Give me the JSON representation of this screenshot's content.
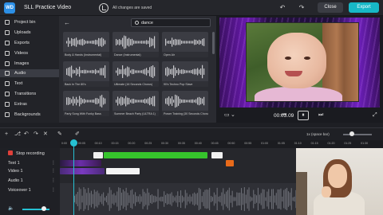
{
  "app": {
    "logo_text": "WD",
    "project_title": "SLL Practice Video",
    "save_status": "All changes are saved",
    "close_label": "Close",
    "export_label": "Export",
    "undo_glyph": "↶",
    "redo_glyph": "↷"
  },
  "sidebar": {
    "active_item": "Audio",
    "items": [
      {
        "label": "Project bin",
        "icon": "bin-icon"
      },
      {
        "label": "Uploads",
        "icon": "upload-icon"
      },
      {
        "label": "Exports",
        "icon": "export-icon"
      },
      {
        "label": "Videos",
        "icon": "video-icon"
      },
      {
        "label": "Images",
        "icon": "image-icon"
      },
      {
        "label": "Audio",
        "icon": "audio-icon"
      },
      {
        "label": "Text",
        "icon": "text-icon"
      },
      {
        "label": "Transitions",
        "icon": "transitions-icon"
      },
      {
        "label": "Extras",
        "icon": "extras-icon"
      },
      {
        "label": "Backgrounds",
        "icon": "backgrounds-icon"
      }
    ]
  },
  "library": {
    "search_value": "dance",
    "back_glyph": "←",
    "tiles": [
      {
        "label": "Body & Hands (Instrumental)"
      },
      {
        "label": "Dance (Instrumental)"
      },
      {
        "label": "Open Air"
      },
      {
        "label": "Back In The 80's"
      },
      {
        "label": "Ultimate (16 Seconds Chorus)"
      },
      {
        "label": "90's Techno Pop Slave"
      },
      {
        "label": "Party Song With Funky Bass"
      },
      {
        "label": "Summer Beach Party (ULTRA 1)"
      },
      {
        "label": "Power Training (30 Seconds Chorus)"
      }
    ]
  },
  "preview": {
    "current_time": "00:03.09",
    "total_time": "/",
    "play_glyph": "⏸",
    "prev_glyph": "⏮",
    "next_glyph": "⏭",
    "fullscreen_glyph": "⤢",
    "speed_label": "1x (space bar)"
  },
  "timeline": {
    "stop_recording_label": "Stop recording",
    "tracks": [
      {
        "name": "Text 1"
      },
      {
        "name": "Video 1"
      },
      {
        "name": "Audio 1"
      },
      {
        "name": "Voiceover 1"
      }
    ],
    "more_glyph": "⋮",
    "ruler_ticks": [
      "0:00",
      "00:05",
      "00:10",
      "00:15",
      "00:20",
      "00:25",
      "00:30",
      "00:35",
      "00:40",
      "00:45",
      "00:50",
      "00:55",
      "01:00",
      "01:05",
      "01:10",
      "01:15",
      "01:20",
      "01:25",
      "01:30"
    ],
    "volume_level": 0.8
  },
  "colors": {
    "accent": "#17b8c7",
    "playhead": "#26c1d2",
    "audio_clip": "#36c42c",
    "text_clip": "#e86a1a",
    "video_clip": "#6a2ea8",
    "record": "#e0403a"
  }
}
